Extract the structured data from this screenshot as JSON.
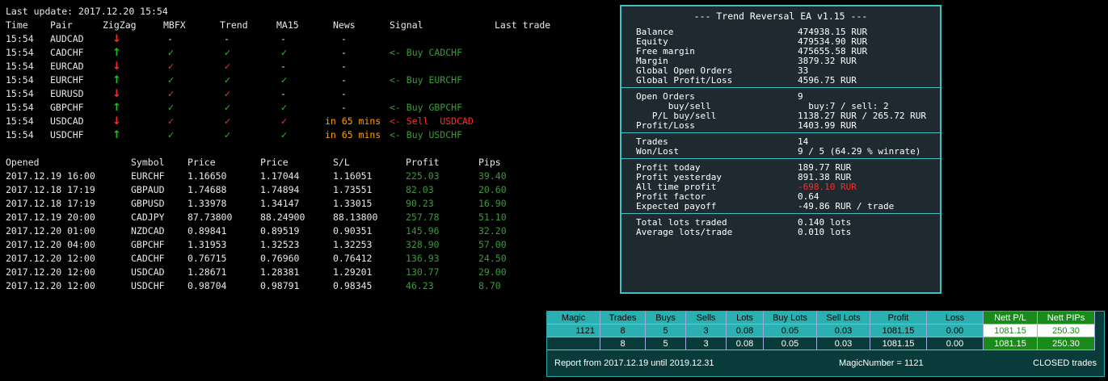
{
  "last_update": "Last update: 2017.12.20 15:54",
  "signal_headers": [
    "Time",
    "Pair",
    "ZigZag",
    "MBFX",
    "Trend",
    "MA15",
    "News",
    "Signal",
    "Last trade"
  ],
  "signals": [
    {
      "time": "15:54",
      "pair": "AUDCAD",
      "zigzag": "down",
      "mbfx": "-",
      "trend": "-",
      "ma15": "-",
      "news": "-",
      "signal": "",
      "signal_color": ""
    },
    {
      "time": "15:54",
      "pair": "CADCHF",
      "zigzag": "up",
      "mbfx": "check-green",
      "trend": "check-green",
      "ma15": "check-green",
      "news": "-",
      "signal": "<- Buy CADCHF",
      "signal_color": "dgreen"
    },
    {
      "time": "15:54",
      "pair": "EURCAD",
      "zigzag": "down",
      "mbfx": "check-red",
      "trend": "check-red",
      "ma15": "-",
      "news": "-",
      "signal": "",
      "signal_color": ""
    },
    {
      "time": "15:54",
      "pair": "EURCHF",
      "zigzag": "up",
      "mbfx": "check-green",
      "trend": "check-green",
      "ma15": "check-green",
      "news": "-",
      "signal": "<- Buy EURCHF",
      "signal_color": "dgreen"
    },
    {
      "time": "15:54",
      "pair": "EURUSD",
      "zigzag": "down",
      "mbfx": "check-red",
      "trend": "check-red",
      "ma15": "-",
      "news": "-",
      "signal": "",
      "signal_color": ""
    },
    {
      "time": "15:54",
      "pair": "GBPCHF",
      "zigzag": "up",
      "mbfx": "check-green",
      "trend": "check-green",
      "ma15": "check-green",
      "news": "-",
      "signal": "<- Buy GBPCHF",
      "signal_color": "dgreen"
    },
    {
      "time": "15:54",
      "pair": "USDCAD",
      "zigzag": "down",
      "mbfx": "check-red",
      "trend": "check-red",
      "ma15": "check-red",
      "news": "in 65 mins",
      "signal": "<- Sell  USDCAD",
      "signal_color": "red"
    },
    {
      "time": "15:54",
      "pair": "USDCHF",
      "zigzag": "up",
      "mbfx": "check-green",
      "trend": "check-green",
      "ma15": "check-green",
      "news": "in 65 mins",
      "signal": "<- Buy USDCHF",
      "signal_color": "dgreen"
    }
  ],
  "trade_headers": [
    "Opened",
    "Symbol",
    "Price",
    "Price",
    "S/L",
    "Profit",
    "Pips"
  ],
  "trades": [
    [
      "2017.12.19 16:00",
      "EURCHF",
      "1.16650",
      "1.17044",
      "1.16051",
      "225.03",
      "39.40"
    ],
    [
      "2017.12.18 17:19",
      "GBPAUD",
      "1.74688",
      "1.74894",
      "1.73551",
      "82.03",
      "20.60"
    ],
    [
      "2017.12.18 17:19",
      "GBPUSD",
      "1.33978",
      "1.34147",
      "1.33015",
      "90.23",
      "16.90"
    ],
    [
      "2017.12.19 20:00",
      "CADJPY",
      "87.73800",
      "88.24900",
      "88.13800",
      "257.78",
      "51.10"
    ],
    [
      "2017.12.20 01:00",
      "NZDCAD",
      "0.89841",
      "0.89519",
      "0.90351",
      "145.96",
      "32.20"
    ],
    [
      "2017.12.20 04:00",
      "GBPCHF",
      "1.31953",
      "1.32523",
      "1.32253",
      "328.90",
      "57.00"
    ],
    [
      "2017.12.20 12:00",
      "CADCHF",
      "0.76715",
      "0.76960",
      "0.76412",
      "136.93",
      "24.50"
    ],
    [
      "2017.12.20 12:00",
      "USDCAD",
      "1.28671",
      "1.28381",
      "1.29201",
      "130.77",
      "29.00"
    ],
    [
      "2017.12.20 12:00",
      "USDCHF",
      "0.98704",
      "0.98791",
      "0.98345",
      "46.23",
      "8.70"
    ]
  ],
  "panel": {
    "title": "--- Trend Reversal EA v1.15 ---",
    "accent": "#3fbfbf",
    "sections": [
      [
        {
          "label": "Balance",
          "value": "474938.15 RUR"
        },
        {
          "label": "Equity",
          "value": "479534.90 RUR"
        },
        {
          "label": "Free margin",
          "value": "475655.58 RUR"
        },
        {
          "label": "Margin",
          "value": "3879.32 RUR"
        },
        {
          "label": "Global Open Orders",
          "value": "33"
        },
        {
          "label": "Global Profit/Loss",
          "value": "4596.75 RUR"
        }
      ],
      [
        {
          "label": "Open Orders",
          "value": "9"
        },
        {
          "label": "      buy/sell",
          "value": "  buy:7 / sell: 2"
        },
        {
          "label": "   P/L buy/sell",
          "value": "1138.27 RUR / 265.72 RUR"
        },
        {
          "label": "Profit/Loss",
          "value": "1403.99 RUR"
        }
      ],
      [
        {
          "label": "Trades",
          "value": "14"
        },
        {
          "label": "Won/Lost",
          "value": "9 / 5 (64.29 % winrate)"
        }
      ],
      [
        {
          "label": "Profit today",
          "value": "189.77 RUR"
        },
        {
          "label": "Profit yesterday",
          "value": "891.38 RUR"
        },
        {
          "label": "All time profit",
          "value": "-698.10 RUR",
          "color": "#ff2a2a"
        },
        {
          "label": "Profit factor",
          "value": "0.64"
        },
        {
          "label": "Expected payoff",
          "value": "-49.86 RUR / trade"
        }
      ],
      [
        {
          "label": "Total lots traded",
          "value": "0.140 lots"
        },
        {
          "label": "Average lots/trade",
          "value": "0.010 lots"
        }
      ]
    ]
  },
  "stats": {
    "headers": [
      "Magic",
      "Trades",
      "Buys",
      "Sells",
      "Lots",
      "Buy Lots",
      "Sell Lots",
      "Profit",
      "Loss",
      "Nett P/L",
      "Nett PIPs"
    ],
    "rows": [
      [
        "1121",
        "8",
        "5",
        "3",
        "0.08",
        "0.05",
        "0.03",
        "1081.15",
        "0.00",
        "1081.15",
        "250.30"
      ],
      [
        "",
        "8",
        "5",
        "3",
        "0.08",
        "0.05",
        "0.03",
        "1081.15",
        "0.00",
        "1081.15",
        "250.30"
      ]
    ],
    "footer_left": "Report from 2017.12.19 until 2019.12.31",
    "footer_mid": "MagicNumber = 1121",
    "footer_right": "CLOSED trades"
  }
}
